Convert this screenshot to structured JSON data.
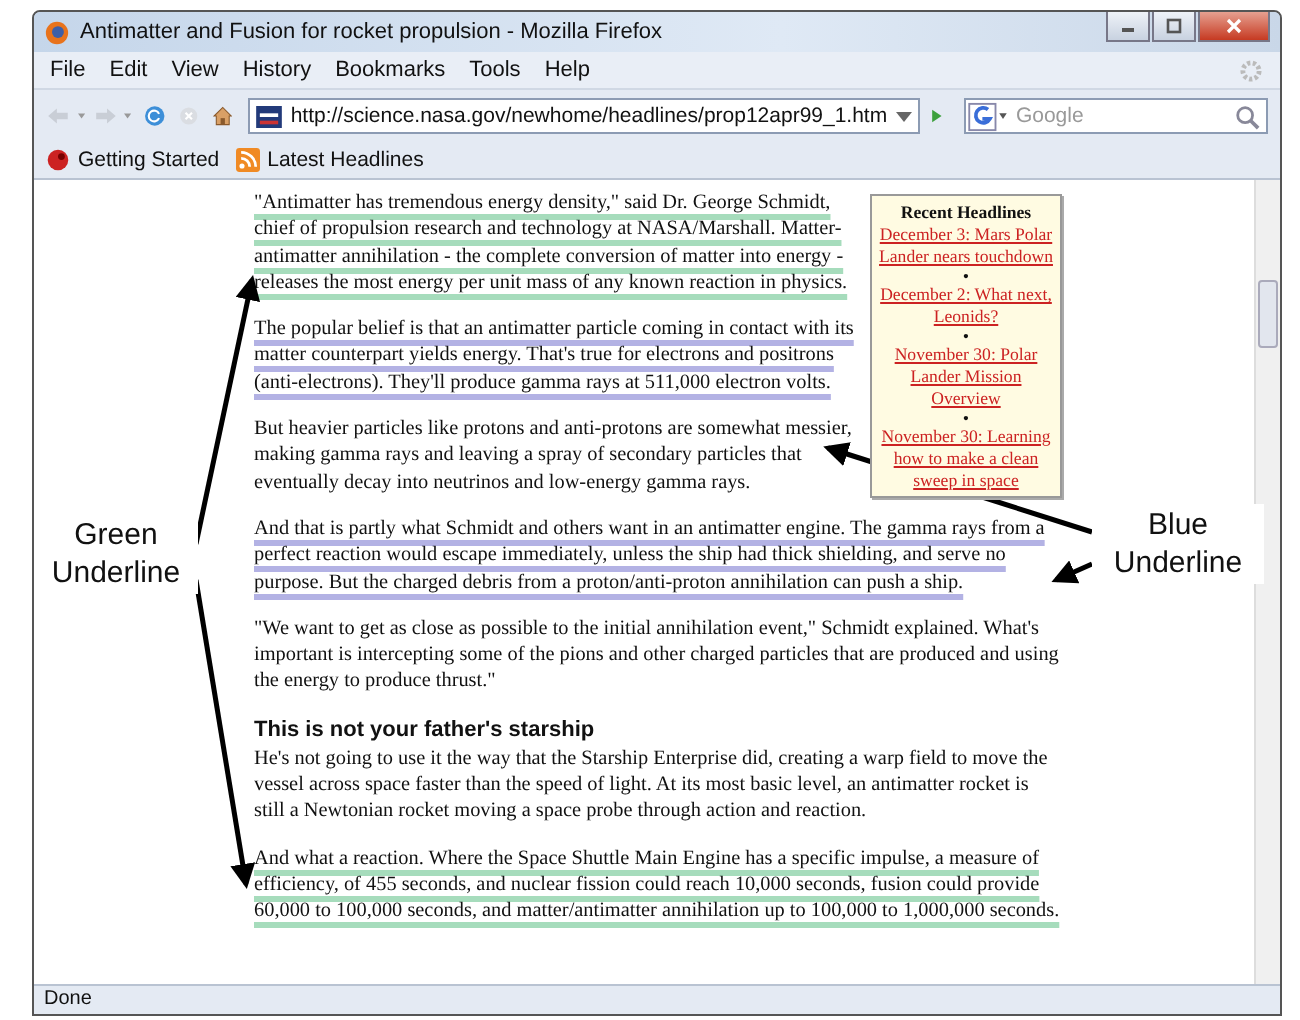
{
  "window": {
    "title": "Antimatter and Fusion for rocket propulsion - Mozilla Firefox"
  },
  "menu": [
    "File",
    "Edit",
    "View",
    "History",
    "Bookmarks",
    "Tools",
    "Help"
  ],
  "toolbar": {
    "url": "http://science.nasa.gov/newhome/headlines/prop12apr99_1.htm",
    "search_placeholder": "Google"
  },
  "bookmarks": [
    "Getting Started",
    "Latest Headlines"
  ],
  "sidebar": {
    "title": "Recent Headlines",
    "separator": "•",
    "links": [
      "December 3: Mars Polar Lander nears touchdown ",
      "December 2: What next, Leonids?",
      "November 30: Polar Lander Mission Overview",
      "November 30: Learning how to make a clean sweep in space "
    ]
  },
  "article": [
    {
      "kind": "paragraph",
      "color": "#a6dcbc",
      "text": "\"Antimatter has tremendous energy density,\" said Dr. George Schmidt, chief of propulsion research and technology at NASA/Marshall. Matter-antimatter annihilation - the complete conversion of matter into energy - releases the most energy per unit mass of any known reaction in physics."
    },
    {
      "kind": "paragraph",
      "color": "#b3b2e4",
      "text": "The popular belief is that an antimatter particle coming in contact with its matter counterpart yields energy. That's true for electrons and positrons (anti-electrons). They'll produce gamma rays at 511,000 electron volts."
    },
    {
      "kind": "paragraph",
      "text": "But heavier particles like protons and anti-protons are somewhat messier, making gamma rays and leaving a spray of secondary particles that eventually decay into neutrinos and low-energy gamma rays."
    },
    {
      "kind": "paragraph",
      "color": "#b3b2e4",
      "text": "And that is partly what Schmidt and others want in an antimatter engine. The gamma rays from a perfect reaction would escape immediately, unless the ship had thick shielding, and serve no purpose. But the charged debris from a proton/anti-proton annihilation can push a ship."
    },
    {
      "kind": "paragraph",
      "text": "\"We want to get as close as possible to the initial annihilation event,\" Schmidt explained. What's important is intercepting some of the pions and other charged particles that are produced and using the energy to produce thrust.\""
    },
    {
      "kind": "heading",
      "text": "This is not your father's starship"
    },
    {
      "kind": "paragraph",
      "text": "He's not going to use it the way that the Starship Enterprise did, creating a warp field to move the vessel across space faster than the speed of light. At its most basic level, an antimatter rocket is still a Newtonian rocket moving a space probe through action and reaction."
    },
    {
      "kind": "paragraph",
      "color": "#a6dcbc",
      "text": "And what a reaction. Where the Space Shuttle Main Engine has a specific impulse, a measure of efficiency, of 455 seconds, and nuclear fission could reach 10,000 seconds, fusion could provide 60,000 to 100,000 seconds, and matter/antimatter annihilation up to 100,000 to 1,000,000 seconds."
    }
  ],
  "status_bar": "Done",
  "annotations": [
    {
      "label": "Green Underline"
    },
    {
      "label": "Blue Underline"
    }
  ]
}
